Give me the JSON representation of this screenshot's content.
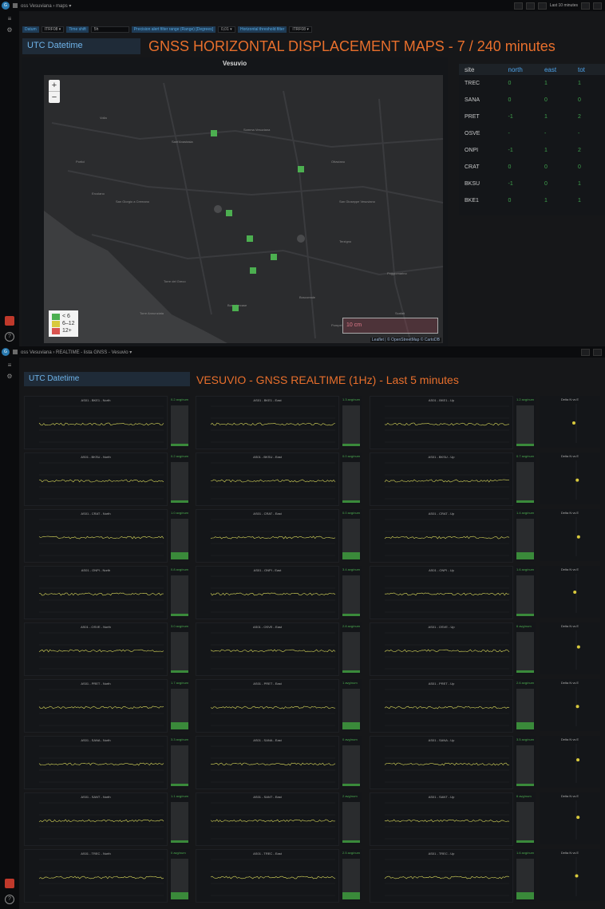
{
  "top": {
    "breadcrumb": "oss Vesuviana › maps ▾",
    "vars": [
      {
        "label": "Datum",
        "value": "ITRF08 ▾"
      },
      {
        "label": "Time shift",
        "value": "5h"
      },
      {
        "label": "Precision alert filter range (Range) [Degrees]",
        "value": "0,01 ▾"
      },
      {
        "label": "Horizontal threshold filter",
        "value": "ITRF08 ▾"
      },
      {
        "label": "Horizontal threshold filter",
        "value": "0.01 ▾"
      }
    ],
    "utc_label": "UTC Datetime",
    "title": "GNSS HORIZONTAL DISPLACEMENT MAPS - 7 / 240 minutes",
    "time_range": "Last 10 minutes"
  },
  "map": {
    "title": "Vesuvio",
    "zoom_in": "+",
    "zoom_out": "−",
    "legend": [
      {
        "label": "< 6",
        "color": "#4caf50"
      },
      {
        "label": "6–12",
        "color": "#d8c93c"
      },
      {
        "label": "12+",
        "color": "#d9534f"
      }
    ],
    "scale_label": "10 cm",
    "attribution": "Leaflet | © OpenStreetMap © CartoDB",
    "place_labels": [
      "Volla",
      "Somma Vesuviana",
      "Sant'Anastasia",
      "Ottaviano",
      "San Giuseppe Vesuviano",
      "Ercolano",
      "Portici",
      "Torre del Greco",
      "San Giorgio a Cremano",
      "Terzigno",
      "Boscoreale",
      "Poggiomarino",
      "Scafati",
      "Pompei",
      "Boscotrecase",
      "Torre Annunziata"
    ]
  },
  "table": {
    "headers": [
      "site",
      "north",
      "east",
      "tot"
    ],
    "rows": [
      {
        "site": "TREC",
        "north": "0",
        "east": "1",
        "tot": "1"
      },
      {
        "site": "SANA",
        "north": "0",
        "east": "0",
        "tot": "0"
      },
      {
        "site": "PRET",
        "north": "-1",
        "east": "1",
        "tot": "2"
      },
      {
        "site": "OSVE",
        "north": "-",
        "east": "-",
        "tot": "-"
      },
      {
        "site": "ONPI",
        "north": "-1",
        "east": "1",
        "tot": "2"
      },
      {
        "site": "CRAT",
        "north": "0",
        "east": "0",
        "tot": "0"
      },
      {
        "site": "BKSU",
        "north": "-1",
        "east": "0",
        "tot": "1"
      },
      {
        "site": "BKE1",
        "north": "0",
        "east": "1",
        "tot": "1"
      }
    ]
  },
  "bottom": {
    "breadcrumb": "oss Vesuviana › REALTIME - lista GNSS - Vesuvio ▾",
    "utc_label": "UTC Datetime",
    "title": "VESUVIO - GNSS REALTIME (1Hz) - Last 5 minutes",
    "rows": [
      {
        "site": "BKE1",
        "gauges": [
          "0.2 avg/num",
          "1.3 avg/num",
          "1.2 avg/num"
        ]
      },
      {
        "site": "BKSU",
        "gauges": [
          "0.2 avg/num",
          "0.0 avg/num",
          "0.7 avg/num"
        ]
      },
      {
        "site": "CRAT",
        "gauges": [
          "1.0 avg/num",
          "0.0 avg/num",
          "1.4 avg/num"
        ]
      },
      {
        "site": "ONPI",
        "gauges": [
          "0.8 avg/num",
          "3.4 avg/num",
          "1.6 avg/num"
        ]
      },
      {
        "site": "OSVE",
        "gauges": [
          "3.0 avg/num",
          "2.8 avg/num",
          "6 avg/num"
        ]
      },
      {
        "site": "PRET",
        "gauges": [
          "1.7 avg/num",
          "1 avg/num",
          "2.6 avg/num"
        ]
      },
      {
        "site": "SANA",
        "gauges": [
          "3.3 avg/num",
          "0 avg/num",
          "3.5 avg/num"
        ]
      },
      {
        "site": "SANT",
        "gauges": [
          "1.1 avg/num",
          "2 avg/num",
          "6 avg/num"
        ]
      },
      {
        "site": "TREC",
        "gauges": [
          "0 avg/num",
          "2.5 avg/num",
          "1.6 avg/num"
        ]
      }
    ],
    "components": [
      "North",
      "East",
      "Up"
    ],
    "scatter_title": "Delta N vs E",
    "accent": "#e86f2c",
    "line_color": "#d8d85a"
  }
}
